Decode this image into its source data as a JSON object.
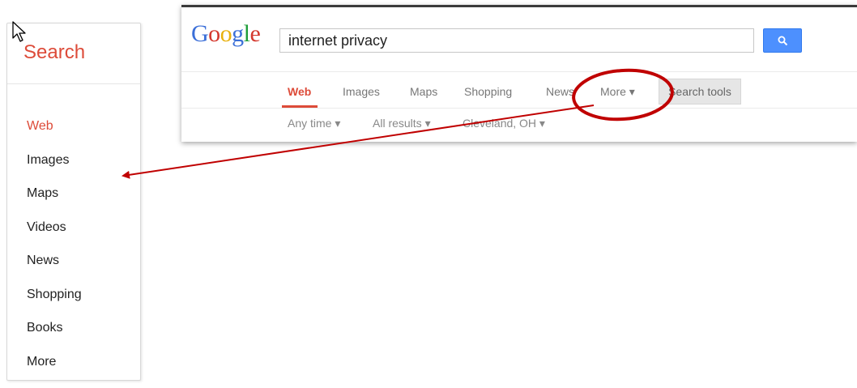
{
  "sidebar": {
    "title": "Search",
    "items": [
      {
        "label": "Web",
        "active": true
      },
      {
        "label": "Images"
      },
      {
        "label": "Maps"
      },
      {
        "label": "Videos"
      },
      {
        "label": "News"
      },
      {
        "label": "Shopping"
      },
      {
        "label": "Books"
      },
      {
        "label": "More"
      }
    ]
  },
  "google": {
    "logo": "Google",
    "query": "internet privacy",
    "search_button_icon": "magnifier-icon",
    "tabs": [
      {
        "label": "Web",
        "active": true
      },
      {
        "label": "Images"
      },
      {
        "label": "Maps"
      },
      {
        "label": "Shopping"
      },
      {
        "label": "News"
      },
      {
        "label": "More ▾"
      }
    ],
    "search_tools": "Search tools",
    "filters": [
      {
        "label": "Any time ▾"
      },
      {
        "label": "All results ▾"
      },
      {
        "label": "Cleveland, OH ▾"
      }
    ]
  },
  "colors": {
    "accent_red": "#dd4b39",
    "search_blue": "#4d90fe",
    "annotation": "#c00000"
  }
}
